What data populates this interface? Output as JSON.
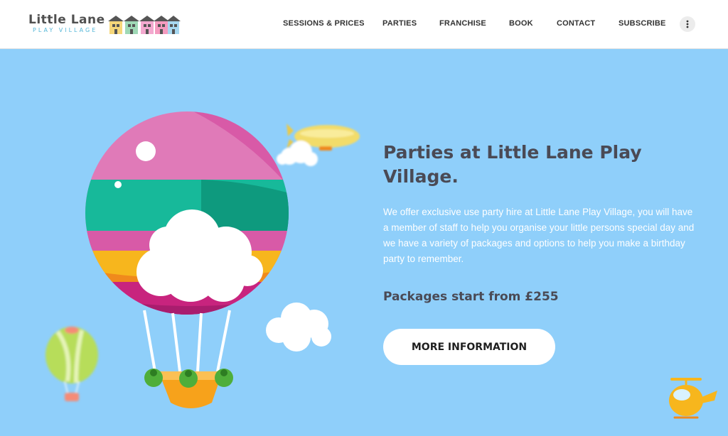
{
  "logo": {
    "title": "Little Lane",
    "subtitle": "PLAY VILLAGE"
  },
  "nav": {
    "items": [
      {
        "label": "SESSIONS & PRICES"
      },
      {
        "label": "PARTIES"
      },
      {
        "label": "FRANCHISE"
      },
      {
        "label": "BOOK"
      },
      {
        "label": "CONTACT"
      },
      {
        "label": "SUBSCRIBE"
      }
    ],
    "more_icon": "vertical-dots-icon"
  },
  "hero": {
    "title": "Parties at Little Lane Play Village.",
    "text": "We offer exclusive use party hire at Little Lane Play Village, you will have a member of staff to help you organise your little persons special day and we have a variety of packages and options to help you make a birthday party to remember.",
    "price": "Packages start from £255",
    "cta_label": "MORE INFORMATION"
  },
  "colors": {
    "sky": "#8fcffa",
    "heading": "#4a4a55",
    "balloon_pink": "#e07ab8",
    "balloon_teal": "#17b99a",
    "balloon_yellow": "#f7b61d",
    "basket": "#f7a21b"
  }
}
